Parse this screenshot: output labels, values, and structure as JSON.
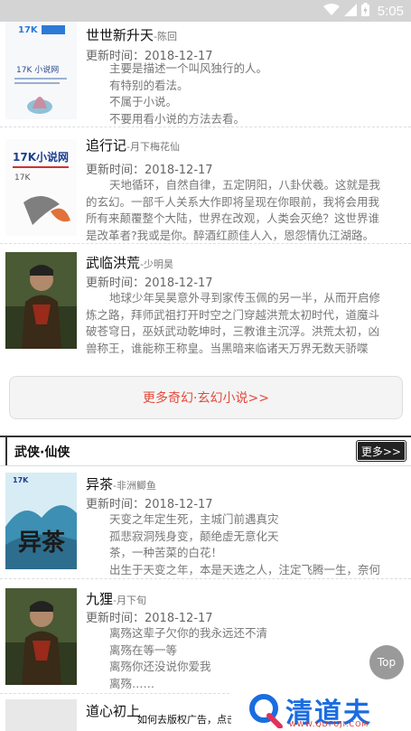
{
  "status_bar": {
    "time": "5:05",
    "icons": [
      "wifi-icon",
      "signal-icon",
      "battery-icon"
    ]
  },
  "category_books": [
    {
      "cover_logo": "17K 小说网",
      "title": "世世新升天",
      "author": "-陈回",
      "update": "更新时间：2018-12-17",
      "desc": [
        "主要是描述一个叫风独行的人。",
        "有特别的看法。",
        "不属于小说。",
        "不要用看小说的方法去看。"
      ]
    },
    {
      "cover_logo": "17K小说网",
      "title": "追行记",
      "author": "-月下梅花仙",
      "update": "更新时间：2018-12-17",
      "desc": [
        "天地循环，自然自律，五定阴阳，八卦伏羲。这就是我",
        "的玄幻。一部千人关系大作即将呈现在你眼前，我将会用我",
        "所有来颠覆整个大陆，世界在改观，人类会灭绝？这世界谁",
        "是改革者?我或是你。醉酒红颜佳人入，恩怨情仇江湖路。"
      ]
    },
    {
      "cover_logo": "",
      "title": "武临洪荒",
      "author": "-少明昊",
      "update": "更新时间：2018-12-17",
      "desc": [
        "地球少年吴昊意外寻到家传玉佩的另一半，从而开启修",
        "炼之路，拜师武祖打开时空之门穿越洪荒太初时代，道魔斗",
        "破苍穹日，巫妖武动乾坤时，三教谁主沉浮。洪荒太初，凶",
        "兽称王，谁能称王称皇。当黑暗来临诸天万界无数天骄喋"
      ]
    }
  ],
  "more_link": "更多奇幻·玄幻小说>>",
  "section": {
    "title": "武侠·仙侠",
    "more": "更多>>"
  },
  "section_books": [
    {
      "cover_title": "异茶",
      "title": "异茶",
      "author": "-非洲鲫鱼",
      "update": "更新时间：2018-12-17",
      "desc": [
        "天变之年定生死，主城门前遇真灾",
        "孤悲寂洞残身变，颠绝虚无意化天",
        "茶，一种苦菜的白花！",
        "出生于天变之年，本是天选之人，注定飞腾一生，奈何"
      ]
    },
    {
      "cover_title": "",
      "title": "九狸",
      "author": "-月下旬",
      "update": "更新时间：2018-12-17",
      "desc": [
        "离殇这辈子欠你的我永远还不清",
        "离殇在等一等",
        "离殇你还没说你爱我",
        "离殇……"
      ]
    }
  ],
  "next_title_partial": "道心初上",
  "top_button": "Top",
  "ad": {
    "text": "如何去版权广告，点击",
    "logo_name": "清道夫",
    "logo_url": "WWW.QDFUJI.COM"
  },
  "colors": {
    "accent_red": "#e34a3b",
    "status_bar": "#d4d4d4",
    "logo_blue": "#1a6de0"
  }
}
